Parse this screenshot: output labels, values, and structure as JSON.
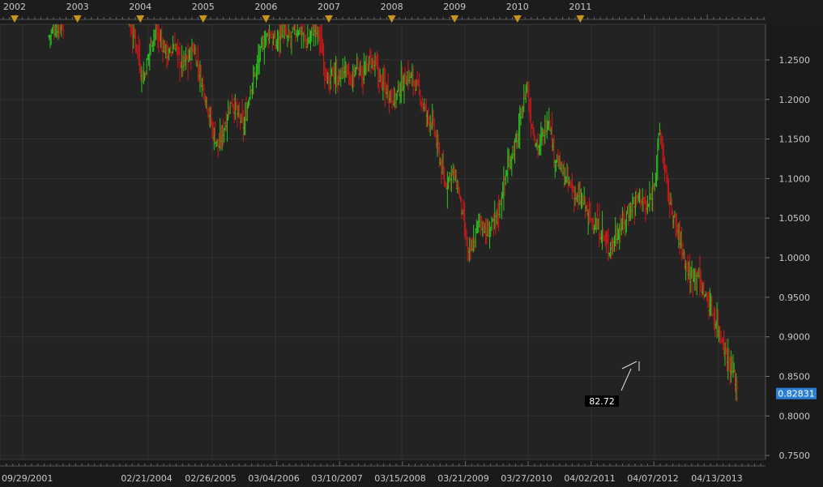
{
  "chart_data": {
    "type": "bar",
    "description_type": "ohlc",
    "colors": {
      "background": "#1a1a1a",
      "plot_bg": "#232323",
      "grid": "#333333",
      "up": "#2ec41f",
      "down": "#d01818",
      "axis_text": "#c8c8c8",
      "year_marker": "#c8941a",
      "price_box_bg": "#2a7fd4",
      "label_box_bg": "#000000"
    },
    "year_labels": [
      "2002",
      "2003",
      "2004",
      "2005",
      "2006",
      "2007",
      "2008",
      "2009",
      "2010",
      "2011"
    ],
    "x_tick_labels": [
      "09/29/2001",
      "02/21/2004",
      "02/26/2005",
      "03/04/2006",
      "03/10/2007",
      "03/15/2008",
      "03/21/2009",
      "03/27/2010",
      "04/02/2011",
      "04/07/2012",
      "04/13/2013"
    ],
    "y_tick_labels": [
      "1.2500",
      "1.2000",
      "1.1500",
      "1.1000",
      "1.0500",
      "1.0000",
      "0.9500",
      "0.9000",
      "0.8500",
      "0.8000",
      "0.7500"
    ],
    "y_ticks": [
      1.25,
      1.2,
      1.15,
      1.1,
      1.05,
      1.0,
      0.95,
      0.9,
      0.85,
      0.8,
      0.75
    ],
    "ylim": [
      0.745,
      1.295
    ],
    "current_price_label": "0.82831",
    "current_price": 0.82831,
    "annotation_label": "82.72",
    "price_path": [
      [
        2002.55,
        1.28
      ],
      [
        2002.65,
        1.29
      ],
      [
        2002.75,
        1.295
      ],
      [
        2003.85,
        1.29
      ],
      [
        2003.95,
        1.27
      ],
      [
        2004.0,
        1.24
      ],
      [
        2004.05,
        1.225
      ],
      [
        2004.1,
        1.245
      ],
      [
        2004.18,
        1.275
      ],
      [
        2004.25,
        1.29
      ],
      [
        2004.35,
        1.27
      ],
      [
        2004.45,
        1.255
      ],
      [
        2004.55,
        1.27
      ],
      [
        2004.65,
        1.245
      ],
      [
        2004.75,
        1.25
      ],
      [
        2004.85,
        1.265
      ],
      [
        2004.95,
        1.23
      ],
      [
        2005.05,
        1.2
      ],
      [
        2005.15,
        1.16
      ],
      [
        2005.25,
        1.14
      ],
      [
        2005.35,
        1.17
      ],
      [
        2005.45,
        1.2
      ],
      [
        2005.55,
        1.18
      ],
      [
        2005.65,
        1.165
      ],
      [
        2005.75,
        1.215
      ],
      [
        2005.85,
        1.24
      ],
      [
        2005.95,
        1.27
      ],
      [
        2006.05,
        1.285
      ],
      [
        2006.15,
        1.27
      ],
      [
        2006.25,
        1.29
      ],
      [
        2006.35,
        1.275
      ],
      [
        2006.45,
        1.285
      ],
      [
        2006.55,
        1.29
      ],
      [
        2006.65,
        1.27
      ],
      [
        2006.75,
        1.29
      ],
      [
        2006.85,
        1.28
      ],
      [
        2006.92,
        1.25
      ],
      [
        2007.0,
        1.215
      ],
      [
        2007.05,
        1.235
      ],
      [
        2007.15,
        1.225
      ],
      [
        2007.25,
        1.24
      ],
      [
        2007.35,
        1.22
      ],
      [
        2007.45,
        1.245
      ],
      [
        2007.55,
        1.23
      ],
      [
        2007.65,
        1.25
      ],
      [
        2007.75,
        1.24
      ],
      [
        2007.85,
        1.22
      ],
      [
        2007.95,
        1.21
      ],
      [
        2008.05,
        1.2
      ],
      [
        2008.15,
        1.22
      ],
      [
        2008.25,
        1.23
      ],
      [
        2008.35,
        1.225
      ],
      [
        2008.45,
        1.205
      ],
      [
        2008.55,
        1.18
      ],
      [
        2008.65,
        1.17
      ],
      [
        2008.75,
        1.13
      ],
      [
        2008.85,
        1.09
      ],
      [
        2008.95,
        1.11
      ],
      [
        2009.05,
        1.09
      ],
      [
        2009.15,
        1.04
      ],
      [
        2009.22,
        1.0
      ],
      [
        2009.3,
        1.02
      ],
      [
        2009.4,
        1.05
      ],
      [
        2009.5,
        1.03
      ],
      [
        2009.6,
        1.04
      ],
      [
        2009.7,
        1.06
      ],
      [
        2009.8,
        1.1
      ],
      [
        2009.9,
        1.13
      ],
      [
        2010.0,
        1.15
      ],
      [
        2010.08,
        1.19
      ],
      [
        2010.15,
        1.22
      ],
      [
        2010.2,
        1.18
      ],
      [
        2010.28,
        1.15
      ],
      [
        2010.35,
        1.14
      ],
      [
        2010.42,
        1.16
      ],
      [
        2010.5,
        1.18
      ],
      [
        2010.58,
        1.13
      ],
      [
        2010.65,
        1.12
      ],
      [
        2010.75,
        1.1
      ],
      [
        2010.85,
        1.09
      ],
      [
        2010.95,
        1.075
      ],
      [
        2011.05,
        1.07
      ],
      [
        2011.15,
        1.05
      ],
      [
        2011.25,
        1.04
      ],
      [
        2011.35,
        1.03
      ],
      [
        2011.45,
        1.01
      ],
      [
        2011.55,
        1.025
      ],
      [
        2011.65,
        1.04
      ],
      [
        2011.75,
        1.055
      ],
      [
        2011.85,
        1.07
      ],
      [
        2011.95,
        1.08
      ],
      [
        2012.05,
        1.06
      ],
      [
        2012.12,
        1.075
      ],
      [
        2012.2,
        1.11
      ],
      [
        2012.26,
        1.16
      ],
      [
        2012.3,
        1.14
      ],
      [
        2012.38,
        1.09
      ],
      [
        2012.45,
        1.06
      ],
      [
        2012.52,
        1.04
      ],
      [
        2012.6,
        1.02
      ],
      [
        2012.68,
        0.99
      ],
      [
        2012.75,
        0.975
      ],
      [
        2012.85,
        0.985
      ],
      [
        2012.92,
        0.965
      ],
      [
        2013.0,
        0.95
      ],
      [
        2013.08,
        0.935
      ],
      [
        2013.18,
        0.915
      ],
      [
        2013.28,
        0.89
      ],
      [
        2013.38,
        0.865
      ],
      [
        2013.45,
        0.85
      ],
      [
        2013.5,
        0.835
      ]
    ]
  }
}
